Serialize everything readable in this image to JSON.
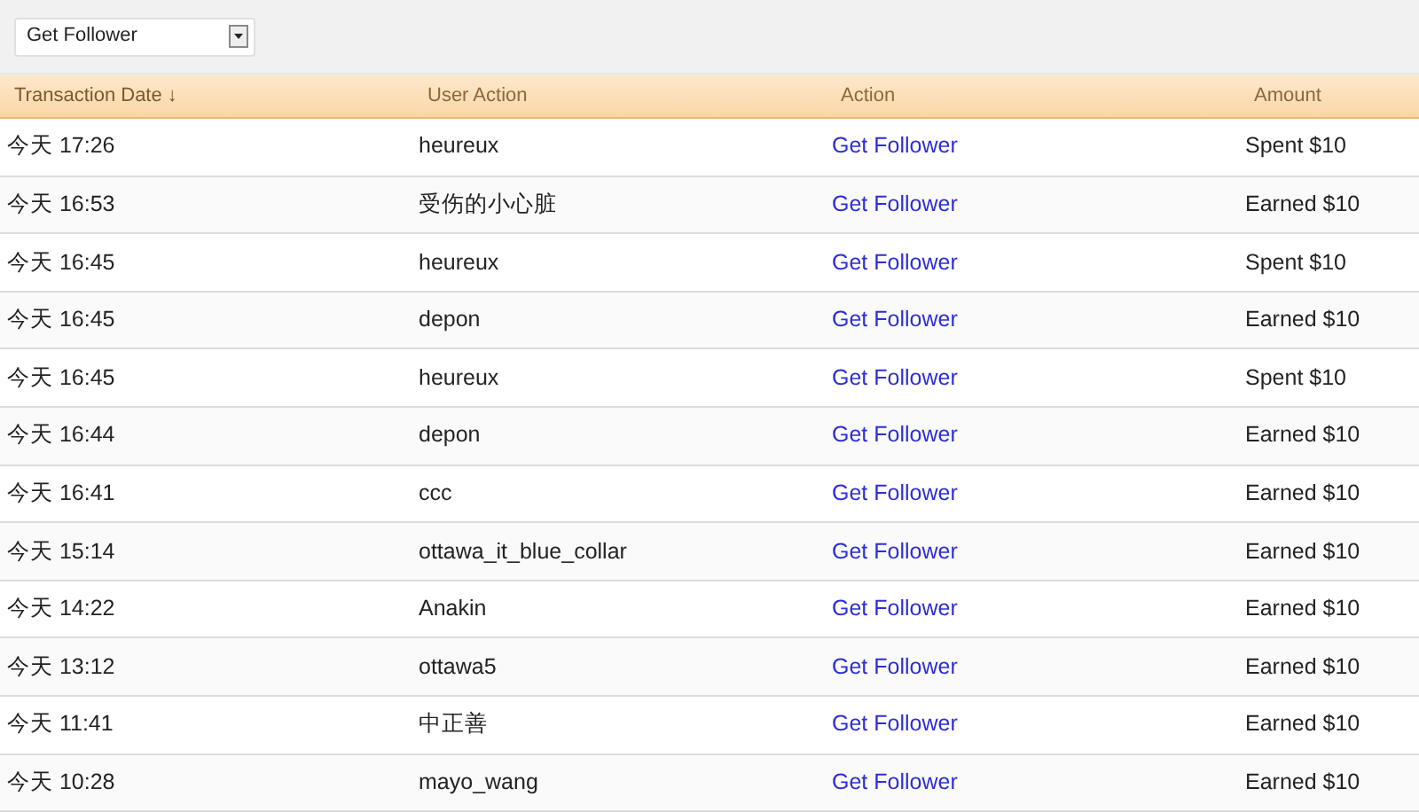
{
  "filter": {
    "value": "Get Follower"
  },
  "table": {
    "columns": [
      {
        "label": "Transaction Date ↓",
        "sorted": true
      },
      {
        "label": "User Action",
        "sorted": false
      },
      {
        "label": "Action",
        "sorted": false
      },
      {
        "label": "Amount",
        "sorted": false
      }
    ],
    "rows": [
      {
        "date": "今天 17:26",
        "user": "heureux",
        "action": "Get Follower",
        "amount": "Spent $10"
      },
      {
        "date": "今天 16:53",
        "user": "受伤的小心脏",
        "action": "Get Follower",
        "amount": "Earned $10"
      },
      {
        "date": "今天 16:45",
        "user": "heureux",
        "action": "Get Follower",
        "amount": "Spent $10"
      },
      {
        "date": "今天 16:45",
        "user": "depon",
        "action": "Get Follower",
        "amount": "Earned $10"
      },
      {
        "date": "今天 16:45",
        "user": "heureux",
        "action": "Get Follower",
        "amount": "Spent $10"
      },
      {
        "date": "今天 16:44",
        "user": "depon",
        "action": "Get Follower",
        "amount": "Earned $10"
      },
      {
        "date": "今天 16:41",
        "user": "ccc",
        "action": "Get Follower",
        "amount": "Earned $10"
      },
      {
        "date": "今天 15:14",
        "user": "ottawa_it_blue_collar",
        "action": "Get Follower",
        "amount": "Earned $10"
      },
      {
        "date": "今天 14:22",
        "user": "Anakin",
        "action": "Get Follower",
        "amount": "Earned $10"
      },
      {
        "date": "今天 13:12",
        "user": "ottawa5",
        "action": "Get Follower",
        "amount": "Earned $10"
      },
      {
        "date": "今天 11:41",
        "user": "中正善",
        "action": "Get Follower",
        "amount": "Earned $10"
      },
      {
        "date": "今天 10:28",
        "user": "mayo_wang",
        "action": "Get Follower",
        "amount": "Earned $10"
      }
    ]
  }
}
